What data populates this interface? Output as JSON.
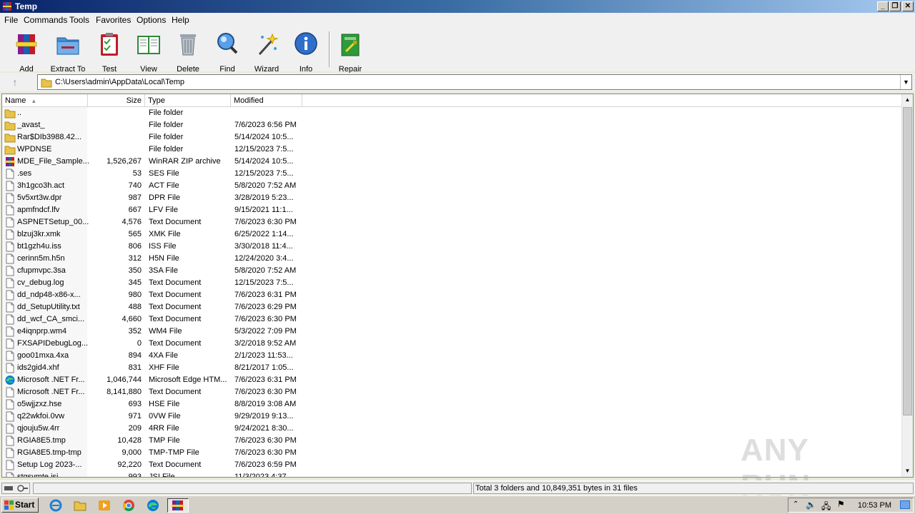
{
  "window": {
    "title": "Temp"
  },
  "menu": [
    "File",
    "Commands",
    "Tools",
    "Favorites",
    "Options",
    "Help"
  ],
  "toolbar": [
    {
      "label": "Add",
      "icon": "add-archive-icon"
    },
    {
      "label": "Extract To",
      "icon": "extract-folder-icon"
    },
    {
      "label": "Test",
      "icon": "test-clipboard-icon"
    },
    {
      "label": "View",
      "icon": "view-book-icon"
    },
    {
      "label": "Delete",
      "icon": "trash-bin-icon"
    },
    {
      "label": "Find",
      "icon": "magnifier-icon"
    },
    {
      "label": "Wizard",
      "icon": "magic-wand-icon"
    },
    {
      "label": "Info",
      "icon": "info-icon"
    },
    {
      "label": "Repair",
      "icon": "repair-kit-icon"
    }
  ],
  "address": {
    "path": "C:\\Users\\admin\\AppData\\Local\\Temp"
  },
  "columns": {
    "name": "Name",
    "size": "Size",
    "type": "Type",
    "modified": "Modified"
  },
  "files": [
    {
      "icon": "folder",
      "name": "..",
      "size": "",
      "type": "File folder",
      "modified": ""
    },
    {
      "icon": "folder",
      "name": "_avast_",
      "size": "",
      "type": "File folder",
      "modified": "7/6/2023 6:56 PM"
    },
    {
      "icon": "folder",
      "name": "Rar$DIb3988.42...",
      "size": "",
      "type": "File folder",
      "modified": "5/14/2024 10:5..."
    },
    {
      "icon": "folder",
      "name": "WPDNSE",
      "size": "",
      "type": "File folder",
      "modified": "12/15/2023 7:5..."
    },
    {
      "icon": "winrar",
      "name": "MDE_File_Sample...",
      "size": "1,526,267",
      "type": "WinRAR ZIP archive",
      "modified": "5/14/2024 10:5..."
    },
    {
      "icon": "file",
      "name": ".ses",
      "size": "53",
      "type": "SES File",
      "modified": "12/15/2023 7:5..."
    },
    {
      "icon": "file",
      "name": "3h1gco3h.act",
      "size": "740",
      "type": "ACT File",
      "modified": "5/8/2020 7:52 AM"
    },
    {
      "icon": "file",
      "name": "5v5xrt3w.dpr",
      "size": "987",
      "type": "DPR File",
      "modified": "3/28/2019 5:23..."
    },
    {
      "icon": "file",
      "name": "apmfndcf.lfv",
      "size": "667",
      "type": "LFV File",
      "modified": "9/15/2021 11:1..."
    },
    {
      "icon": "file",
      "name": "ASPNETSetup_00...",
      "size": "4,576",
      "type": "Text Document",
      "modified": "7/6/2023 6:30 PM"
    },
    {
      "icon": "file",
      "name": "blzuj3kr.xmk",
      "size": "565",
      "type": "XMK File",
      "modified": "6/25/2022 1:14..."
    },
    {
      "icon": "file",
      "name": "bt1gzh4u.iss",
      "size": "806",
      "type": "ISS File",
      "modified": "3/30/2018 11:4..."
    },
    {
      "icon": "file",
      "name": "cerinn5m.h5n",
      "size": "312",
      "type": "H5N File",
      "modified": "12/24/2020 3:4..."
    },
    {
      "icon": "file",
      "name": "cfupmvpc.3sa",
      "size": "350",
      "type": "3SA File",
      "modified": "5/8/2020 7:52 AM"
    },
    {
      "icon": "file",
      "name": "cv_debug.log",
      "size": "345",
      "type": "Text Document",
      "modified": "12/15/2023 7:5..."
    },
    {
      "icon": "file",
      "name": "dd_ndp48-x86-x...",
      "size": "980",
      "type": "Text Document",
      "modified": "7/6/2023 6:31 PM"
    },
    {
      "icon": "file",
      "name": "dd_SetupUtility.txt",
      "size": "488",
      "type": "Text Document",
      "modified": "7/6/2023 6:29 PM"
    },
    {
      "icon": "file",
      "name": "dd_wcf_CA_smci...",
      "size": "4,660",
      "type": "Text Document",
      "modified": "7/6/2023 6:30 PM"
    },
    {
      "icon": "file",
      "name": "e4iqnprp.wm4",
      "size": "352",
      "type": "WM4 File",
      "modified": "5/3/2022 7:09 PM"
    },
    {
      "icon": "file",
      "name": "FXSAPIDebugLog...",
      "size": "0",
      "type": "Text Document",
      "modified": "3/2/2018 9:52 AM"
    },
    {
      "icon": "file",
      "name": "goo01mxa.4xa",
      "size": "894",
      "type": "4XA File",
      "modified": "2/1/2023 11:53..."
    },
    {
      "icon": "file",
      "name": "ids2gid4.xhf",
      "size": "831",
      "type": "XHF File",
      "modified": "8/21/2017 1:05..."
    },
    {
      "icon": "edge",
      "name": "Microsoft .NET Fr...",
      "size": "1,046,744",
      "type": "Microsoft Edge HTM...",
      "modified": "7/6/2023 6:31 PM"
    },
    {
      "icon": "file",
      "name": "Microsoft .NET Fr...",
      "size": "8,141,880",
      "type": "Text Document",
      "modified": "7/6/2023 6:30 PM"
    },
    {
      "icon": "file",
      "name": "o5wjjzxz.hse",
      "size": "693",
      "type": "HSE File",
      "modified": "8/8/2019 3:08 AM"
    },
    {
      "icon": "file",
      "name": "q22wkfoi.0vw",
      "size": "971",
      "type": "0VW File",
      "modified": "9/29/2019 9:13..."
    },
    {
      "icon": "file",
      "name": "qjouju5w.4rr",
      "size": "209",
      "type": "4RR File",
      "modified": "9/24/2021 8:30..."
    },
    {
      "icon": "file",
      "name": "RGIA8E5.tmp",
      "size": "10,428",
      "type": "TMP File",
      "modified": "7/6/2023 6:30 PM"
    },
    {
      "icon": "file",
      "name": "RGIA8E5.tmp-tmp",
      "size": "9,000",
      "type": "TMP-TMP File",
      "modified": "7/6/2023 6:30 PM"
    },
    {
      "icon": "file",
      "name": "Setup Log 2023-...",
      "size": "92,220",
      "type": "Text Document",
      "modified": "7/6/2023 6:59 PM"
    },
    {
      "icon": "file",
      "name": "stgsvmte.jsi",
      "size": "993",
      "type": "JSI File",
      "modified": "11/3/2023 4:37..."
    }
  ],
  "status": {
    "summary": "Total 3 folders and 10,849,351 bytes in 31 files"
  },
  "taskbar": {
    "start_label": "Start",
    "clock": "10:53 PM",
    "apps": [
      "ie-icon",
      "explorer-icon",
      "media-player-icon",
      "chrome-icon",
      "edge-icon",
      "winrar-icon"
    ]
  },
  "watermark": "ANY RUN",
  "colors": {
    "titlebar_start": "#0a246a",
    "titlebar_end": "#a6caf0",
    "folder": "#e8c34a",
    "accent": "#0078d7"
  }
}
